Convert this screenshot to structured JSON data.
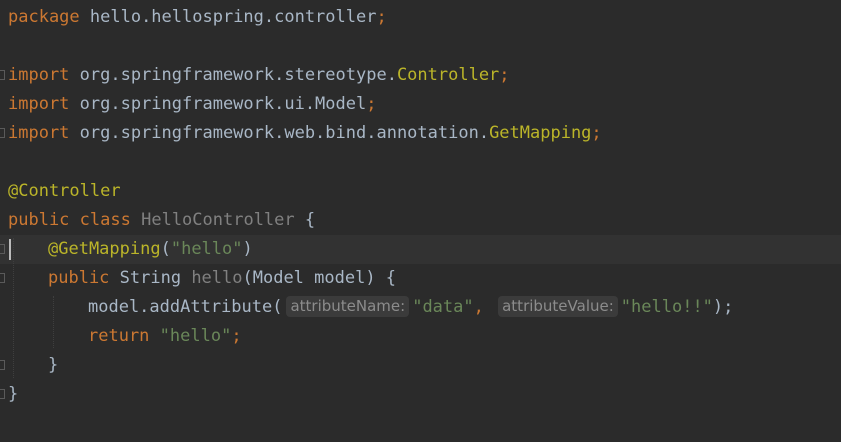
{
  "editor": {
    "line_package": {
      "keyword": "package",
      "name": " hello.hellospring.controller",
      "semicolon": ";"
    },
    "imports": [
      {
        "keyword": "import",
        "path": " org.springframework.stereotype.",
        "cls": "Controller",
        "semicolon": ";"
      },
      {
        "keyword": "import",
        "path": " org.springframework.ui.Model",
        "cls": "",
        "semicolon": ";"
      },
      {
        "keyword": "import",
        "path": " org.springframework.web.bind.annotation.",
        "cls": "GetMapping",
        "semicolon": ";"
      }
    ],
    "class_annotation": "@Controller",
    "class_decl": {
      "mod": "public",
      "kw": "class",
      "name": "HelloController",
      "brace": " {"
    },
    "method_annotation": {
      "name": "@GetMapping",
      "open": "(",
      "arg": "\"hello\"",
      "close": ")"
    },
    "method_decl": {
      "mod": "public",
      "ret_type": " String ",
      "name": "hello",
      "params": "(Model model) {"
    },
    "add_attr": {
      "call": "model.addAttribute(",
      "hint1": "attributeName:",
      "arg1": "\"data\"",
      "comma": ", ",
      "hint2": "attributeValue:",
      "arg2": "\"hello!!\"",
      "end": ");"
    },
    "return_stmt": {
      "kw": "return",
      "value": "\"hello\"",
      "semicolon": ";"
    },
    "method_close": "}",
    "class_close": "}"
  },
  "colors": {
    "background": "#2b2b2b",
    "keyword": "#cc7832",
    "annotation": "#bbb529",
    "string": "#6a8759",
    "text": "#a9b7c6"
  }
}
